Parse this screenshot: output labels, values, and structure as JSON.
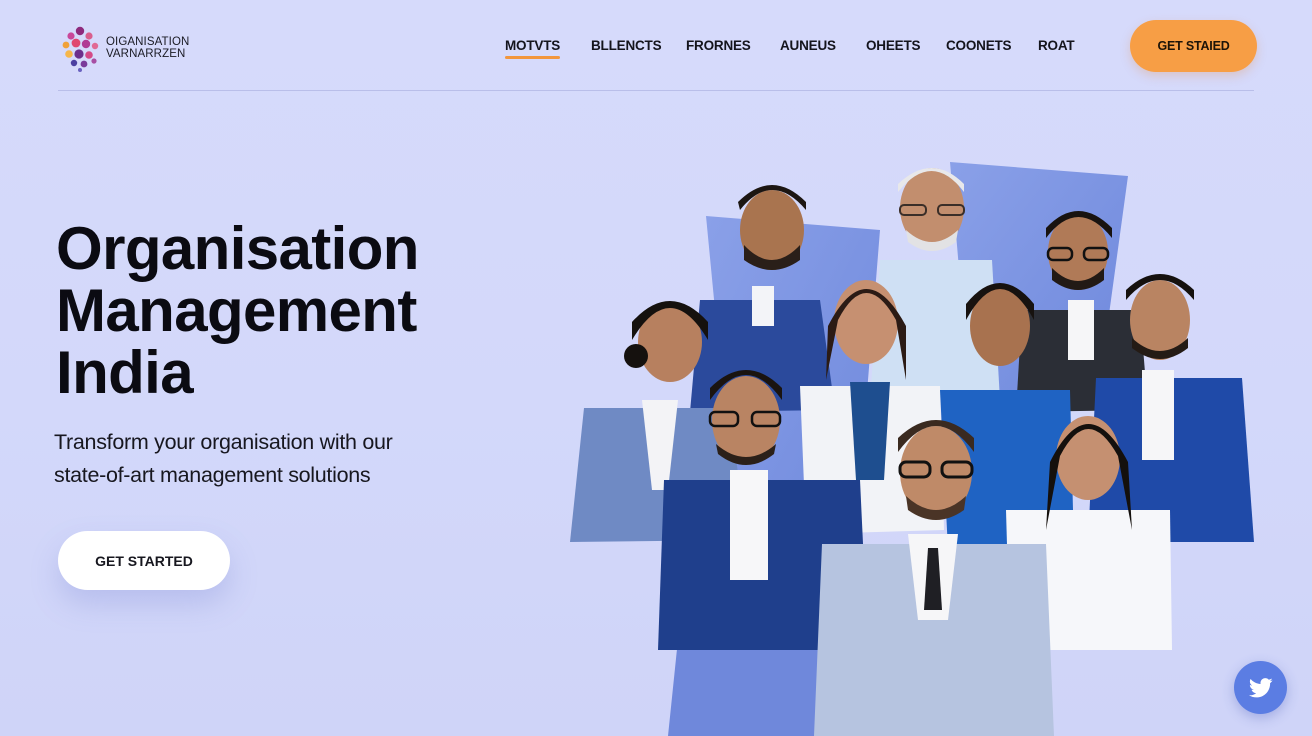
{
  "brand": {
    "line1": "OIGANISATION",
    "line2": "VARNARRZEN"
  },
  "nav": {
    "items": [
      {
        "label": "MOTVTS",
        "active": true
      },
      {
        "label": "BLLENCTS",
        "active": false
      },
      {
        "label": "FRORNES",
        "active": false
      },
      {
        "label": "AUNEUS",
        "active": false
      },
      {
        "label": "OHEETS",
        "active": false
      },
      {
        "label": "COONETS",
        "active": false
      },
      {
        "label": "ROAT",
        "active": false
      }
    ],
    "cta_label": "GET STAIED"
  },
  "hero": {
    "title_line1": "Organisation",
    "title_line2": "Management",
    "title_line3": "India",
    "subtitle_line1": "Transform your organisation with our",
    "subtitle_line2": "state-of-art management solutions",
    "cta_label": "GET STARTED"
  },
  "illustration": {
    "people_count": 11,
    "backdrop_color": "#7b93e2"
  },
  "social": {
    "icon": "twitter-icon"
  },
  "colors": {
    "background": "#d4d9fa",
    "accent_orange": "#f79e45",
    "navy": "#1d3f8f",
    "social_blue": "#5b7de3"
  }
}
